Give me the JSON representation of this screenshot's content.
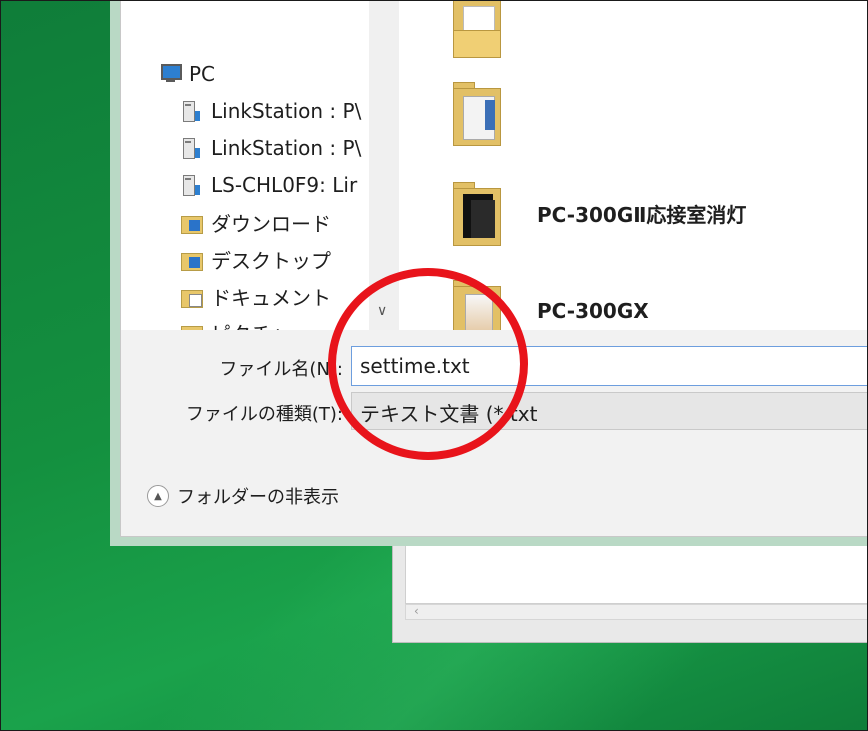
{
  "nav": {
    "items": [
      {
        "label": "PC",
        "icon": "pc-icon"
      },
      {
        "label": "LinkStation : P\\",
        "icon": "network-drive-icon"
      },
      {
        "label": "LinkStation : P\\",
        "icon": "network-drive-icon"
      },
      {
        "label": "LS-CHL0F9: Lir",
        "icon": "network-drive-icon"
      },
      {
        "label": "ダウンロード",
        "icon": "downloads-folder-icon"
      },
      {
        "label": "デスクトップ",
        "icon": "desktop-folder-icon"
      },
      {
        "label": "ドキュメント",
        "icon": "documents-folder-icon"
      },
      {
        "label": "ピクチャ",
        "icon": "pictures-folder-icon"
      }
    ]
  },
  "files": {
    "items": [
      {
        "name": "",
        "icon": "folder-icon"
      },
      {
        "name": "",
        "icon": "folder-icon"
      },
      {
        "name": "PC-300GⅡ応接室消灯",
        "icon": "folder-icon"
      },
      {
        "name": "PC-300GX",
        "icon": "folder-icon"
      }
    ]
  },
  "form": {
    "filename_label": "ファイル名(N):",
    "filename_value": "settime.txt",
    "filetype_label": "ファイルの種類(T):",
    "filetype_value": "テキスト文書 (*.txt"
  },
  "footer": {
    "hide_folders_label": "フォルダーの非表示"
  },
  "annotation": {
    "ring_color": "#e8141b"
  }
}
